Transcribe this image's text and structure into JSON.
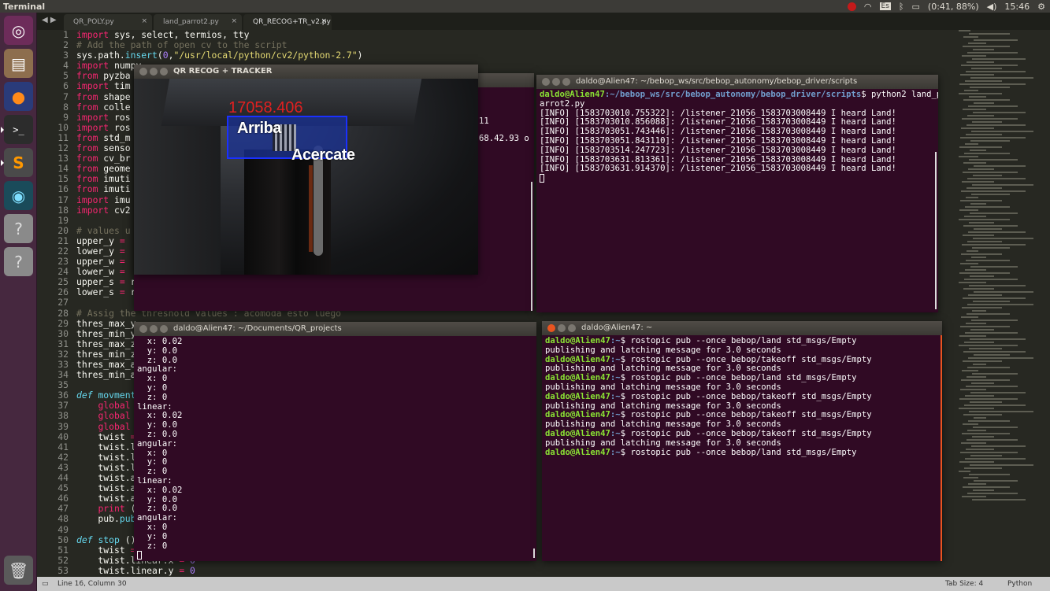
{
  "top_panel": {
    "app_title": "Terminal",
    "battery": "(0:41, 88%)",
    "keyboard_layout": "Es",
    "clock": "15:46"
  },
  "editor": {
    "tabs": [
      {
        "label": "QR_POLY.py"
      },
      {
        "label": "land_parrot2.py"
      },
      {
        "label": "QR_RECOG+TR_v2.py",
        "active": true
      }
    ],
    "line_numbers": [
      "1",
      "2",
      "3",
      "4",
      "5",
      "6",
      "7",
      "8",
      "9",
      "10",
      "11",
      "12",
      "13",
      "14",
      "15",
      "16",
      "17",
      "18",
      "19",
      "20",
      "21",
      "22",
      "23",
      "24",
      "25",
      "26",
      "27",
      "28",
      "29",
      "30",
      "31",
      "32",
      "33",
      "34",
      "35",
      "36",
      "37",
      "38",
      "39",
      "40",
      "41",
      "42",
      "43",
      "44",
      "45",
      "46",
      "47",
      "48",
      "49",
      "50",
      "51",
      "52",
      "53"
    ],
    "statusbar": {
      "position": "Line 16, Column 30",
      "tab_size": "Tab Size: 4",
      "syntax": "Python"
    }
  },
  "windows": {
    "camera": {
      "title": "QR RECOG + TRACKER",
      "value": "17058.406",
      "label_up": "Arriba",
      "label_near": "Acercate"
    },
    "hidden_term": {
      "frag1": "11",
      "frag2": "68.42.93 o"
    },
    "listener": {
      "title": "daldo@Alien47: ~/bebop_ws/src/bebop_autonomy/bebop_driver/scripts",
      "prompt_user": "daldo@Alien47",
      "prompt_path": ":~/bebop_ws/src/bebop_autonomy/bebop_driver/scripts",
      "command": "$ python2 land_p",
      "command_wrap": "arrot2.py",
      "lines": [
        "[INFO] [1583703010.755322]: /listener_21056_1583703008449 I heard Land!",
        "[INFO] [1583703010.856088]: /listener_21056_1583703008449 I heard Land!",
        "[INFO] [1583703051.743446]: /listener_21056_1583703008449 I heard Land!",
        "[INFO] [1583703051.843110]: /listener_21056_1583703008449 I heard Land!",
        "[INFO] [1583703514.247723]: /listener_21056_1583703008449 I heard Land!",
        "[INFO] [1583703631.813361]: /listener_21056_1583703008449 I heard Land!",
        "[INFO] [1583703631.914370]: /listener_21056_1583703008449 I heard Land!"
      ]
    },
    "twist": {
      "title": "daldo@Alien47: ~/Documents/QR_projects",
      "lines": [
        "  x: 0.02",
        "  y: 0.0",
        "  z: 0.0",
        "angular:",
        "  x: 0",
        "  y: 0",
        "  z: 0",
        "linear:",
        "  x: 0.02",
        "  y: 0.0",
        "  z: 0.0",
        "angular:",
        "  x: 0",
        "  y: 0",
        "  z: 0",
        "linear:",
        "  x: 0.02",
        "  y: 0.0",
        "  z: 0.0",
        "angular:",
        "  x: 0",
        "  y: 0",
        "  z: 0"
      ]
    },
    "rostopic": {
      "title": "daldo@Alien47: ~",
      "prompt": "daldo@Alien47",
      "path": ":~",
      "entries": [
        {
          "cmd": "$ rostopic pub --once bebop/land std_msgs/Empty",
          "out": "publishing and latching message for 3.0 seconds"
        },
        {
          "cmd": "$ rostopic pub --once bebop/takeoff std_msgs/Empty",
          "out": "publishing and latching message for 3.0 seconds"
        },
        {
          "cmd": "$ rostopic pub --once bebop/land std_msgs/Empty",
          "out": "publishing and latching message for 3.0 seconds"
        },
        {
          "cmd": "$ rostopic pub --once bebop/takeoff std_msgs/Empty",
          "out": "publishing and latching message for 3.0 seconds"
        },
        {
          "cmd": "$ rostopic pub --once bebop/takeoff std_msgs/Empty",
          "out": "publishing and latching message for 3.0 seconds"
        },
        {
          "cmd": "$ rostopic pub --once bebop/takeoff std_msgs/Empty",
          "out": "publishing and latching message for 3.0 seconds"
        },
        {
          "cmd": "$ rostopic pub --once bebop/land std_msgs/Empty",
          "out": ""
        }
      ]
    }
  },
  "colors": {
    "terminal_bg": "#300a24",
    "editor_bg": "#272822",
    "launcher_bg": "#46283f",
    "accent_orange": "#e95420"
  }
}
